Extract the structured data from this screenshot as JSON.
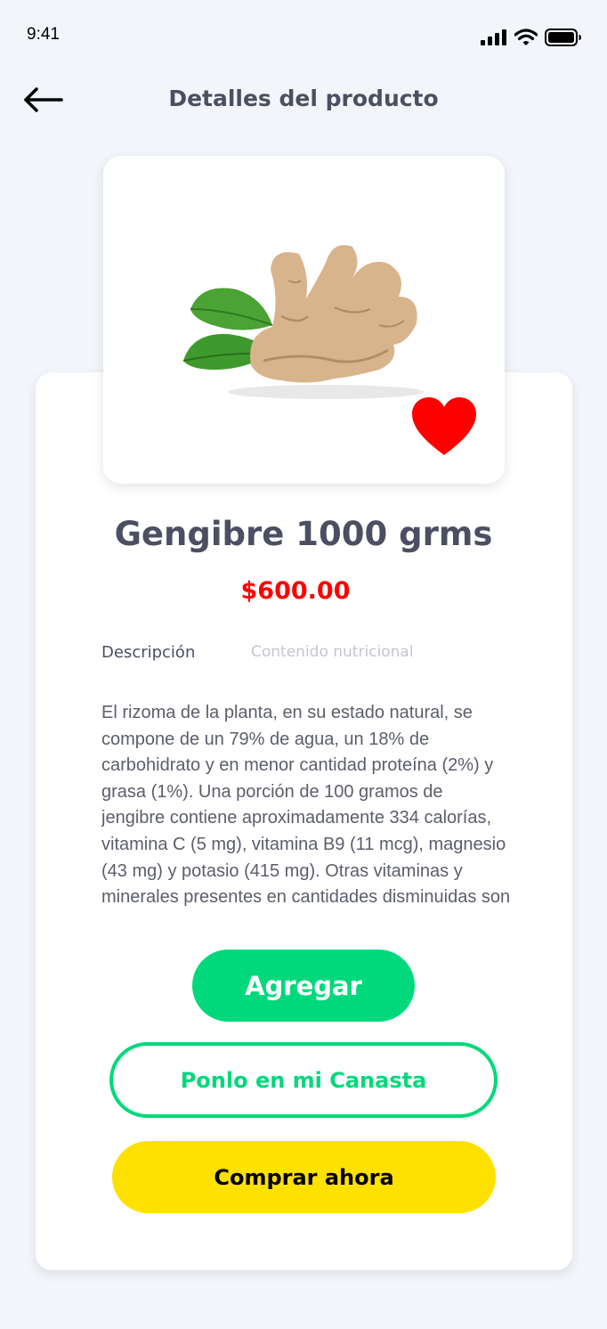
{
  "status_bar": {
    "time": "9:41"
  },
  "header": {
    "title": "Detalles del producto"
  },
  "product": {
    "name": "Gengibre 1000 grms",
    "price": "$600.00",
    "is_favorite": true
  },
  "tabs": [
    {
      "label": "Descripción",
      "active": true
    },
    {
      "label": "Contenido nutricional",
      "active": false
    }
  ],
  "description": "El rizoma de la planta, en su estado natural, se compone de un 79% de agua, un 18% de carbohidrato y en menor cantidad proteína (2%) y grasa (1%). Una porción de 100 gramos de jengibre contiene aproximadamente 334 calorías, vitamina C (5 mg), vitamina B9 (11 mcg), magnesio (43 mg) y potasio (415 mg). Otras vitaminas y minerales presentes en cantidades disminuidas son",
  "actions": {
    "add_label": "Agregar",
    "basket_label": "Ponlo en mi Canasta",
    "buy_label": "Comprar ahora"
  },
  "colors": {
    "accent_green": "#00d97b",
    "price_red": "#ff0000",
    "buy_yellow": "#ffe100",
    "heart_red": "#ff0000",
    "title_gray": "#4b4f61"
  },
  "icons": {
    "back": "arrow-left-icon",
    "favorite": "heart-icon",
    "signal": "cellular-signal-icon",
    "wifi": "wifi-icon",
    "battery": "battery-icon"
  }
}
